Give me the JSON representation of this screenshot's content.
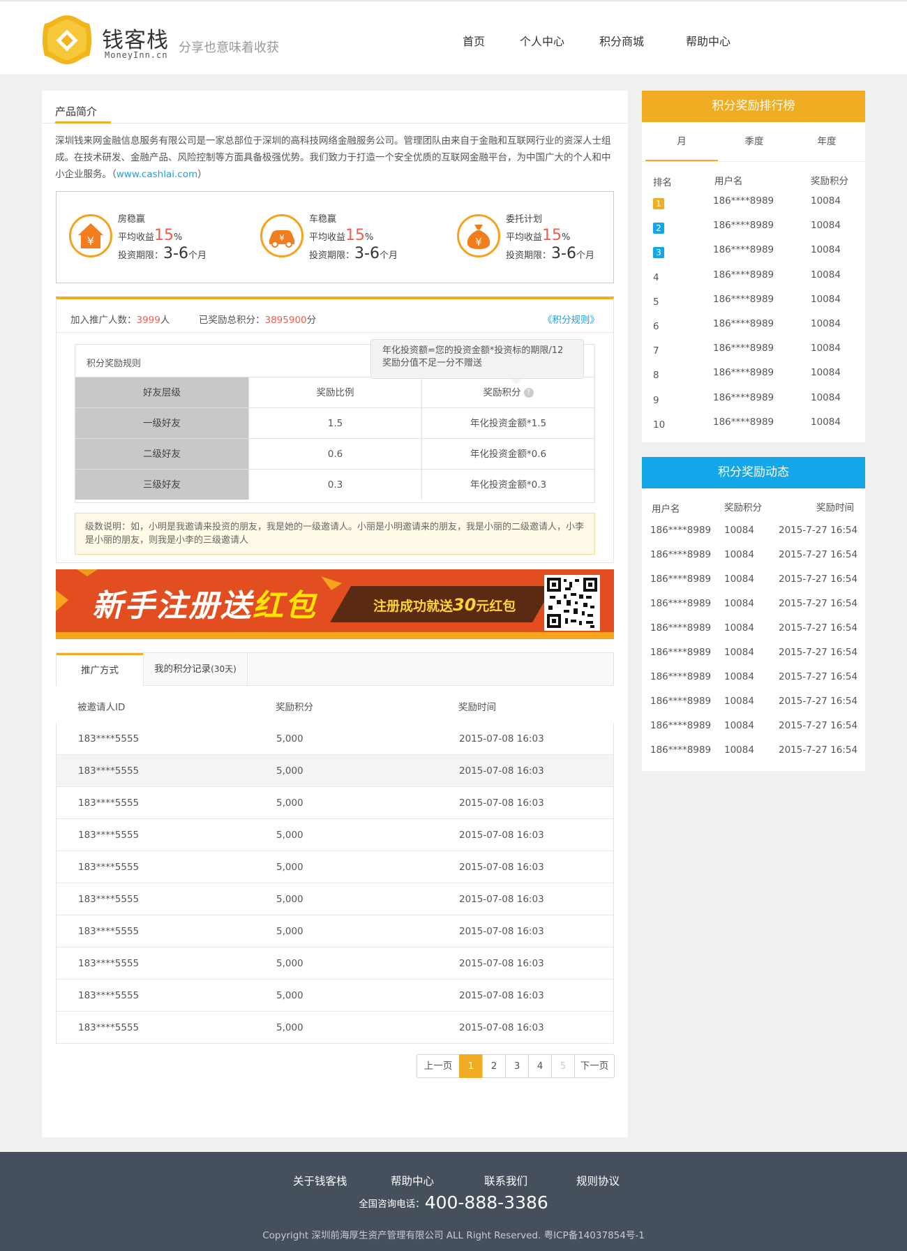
{
  "header": {
    "logo_text": "钱客栈",
    "logo_sub": "MoneyInn.cn",
    "slogan": "分享也意味着收获",
    "nav": [
      "首页",
      "个人中心",
      "积分商城",
      "帮助中心"
    ]
  },
  "intro": {
    "title": "产品简介",
    "text": "深圳钱来网金融信息服务有限公司是一家总部位于深圳的高科技网络金融服务公司。管理团队由来自于金融和互联网行业的资深人士组成。在技术研发、金融产品、风险控制等方面具备极强优势。我们致力于打造一个安全优质的互联网金融平台，为中国广大的个人和中小企业服务。（",
    "link": "www.cashlai.com",
    "tail": "）"
  },
  "products": [
    {
      "name": "房稳赢",
      "icon": "house-yuan-icon",
      "rate_label": "平均收益",
      "rate": "15",
      "rate_unit": "%",
      "term_label": "投资期限：",
      "term": "3-6",
      "term_unit": "个月"
    },
    {
      "name": "车稳赢",
      "icon": "car-yuan-icon",
      "rate_label": "平均收益",
      "rate": "15",
      "rate_unit": "%",
      "term_label": "投资期限：",
      "term": "3-6",
      "term_unit": "个月"
    },
    {
      "name": "委托计划",
      "icon": "moneybag-yuan-icon",
      "rate_label": "平均收益",
      "rate": "15",
      "rate_unit": "%",
      "term_label": "投资期限：",
      "term": "3-6",
      "term_unit": "个月"
    }
  ],
  "promo": {
    "joined_label": "加入推广人数：",
    "joined_value": "3999",
    "joined_unit": "人",
    "points_label": "已奖励总积分：",
    "points_value": "3895900",
    "points_unit": "分",
    "rules_link": "《积分规则》",
    "rules_title": "积分奖励规则",
    "tooltip_line1": "年化投资额=您的投资金额*投资标的期限/12",
    "tooltip_line2": "奖励分值不足一分不赠送",
    "headers": [
      "好友层级",
      "奖励比例",
      "奖励积分"
    ],
    "rows": [
      [
        "一级好友",
        "1.5",
        "年化投资金额*1.5"
      ],
      [
        "二级好友",
        "0.6",
        "年化投资金额*0.6"
      ],
      [
        "三级好友",
        "0.3",
        "年化投资金额*0.3"
      ]
    ],
    "note": "级数说明：如，小明是我邀请来投资的朋友，我是她的一级邀请人。小丽是小明邀请来的朋友，我是小丽的二级邀请人，小李是小丽的朋友，则我是小李的三级邀请人"
  },
  "banner": {
    "main_a": "新手注册送",
    "main_b": "红包",
    "sub_a": "注册成功就送",
    "sub_num": "30",
    "sub_b": "元红包"
  },
  "records": {
    "tabs": [
      "推广方式",
      "我的积分记录"
    ],
    "tab2_suffix": "(30天)",
    "headers": [
      "被邀请人ID",
      "奖励积分",
      "奖励时间"
    ],
    "rows": [
      [
        "183****5555",
        "5,000",
        "2015-07-08  16:03"
      ],
      [
        "183****5555",
        "5,000",
        "2015-07-08  16:03"
      ],
      [
        "183****5555",
        "5,000",
        "2015-07-08  16:03"
      ],
      [
        "183****5555",
        "5,000",
        "2015-07-08  16:03"
      ],
      [
        "183****5555",
        "5,000",
        "2015-07-08  16:03"
      ],
      [
        "183****5555",
        "5,000",
        "2015-07-08  16:03"
      ],
      [
        "183****5555",
        "5,000",
        "2015-07-08  16:03"
      ],
      [
        "183****5555",
        "5,000",
        "2015-07-08  16:03"
      ],
      [
        "183****5555",
        "5,000",
        "2015-07-08  16:03"
      ],
      [
        "183****5555",
        "5,000",
        "2015-07-08  16:03"
      ]
    ]
  },
  "pager": {
    "prev": "上一页",
    "pages": [
      "1",
      "2",
      "3",
      "4",
      "5"
    ],
    "next": "下一页",
    "current": "1"
  },
  "ranking": {
    "title": "积分奖励排行榜",
    "tabs": [
      "月",
      "季度",
      "年度"
    ],
    "headers": [
      "排名",
      "用户名",
      "奖励积分"
    ],
    "rows": [
      [
        "1",
        "186****8989",
        "10084"
      ],
      [
        "2",
        "186****8989",
        "10084"
      ],
      [
        "3",
        "186****8989",
        "10084"
      ],
      [
        "4",
        "186****8989",
        "10084"
      ],
      [
        "5",
        "186****8989",
        "10084"
      ],
      [
        "6",
        "186****8989",
        "10084"
      ],
      [
        "7",
        "186****8989",
        "10084"
      ],
      [
        "8",
        "186****8989",
        "10084"
      ],
      [
        "9",
        "186****8989",
        "10084"
      ],
      [
        "10",
        "186****8989",
        "10084"
      ]
    ]
  },
  "feed": {
    "title": "积分奖励动态",
    "headers": [
      "用户名",
      "奖励积分",
      "奖励时间"
    ],
    "rows": [
      [
        "186****8989",
        "10084",
        "2015-7-27  16:54"
      ],
      [
        "186****8989",
        "10084",
        "2015-7-27  16:54"
      ],
      [
        "186****8989",
        "10084",
        "2015-7-27  16:54"
      ],
      [
        "186****8989",
        "10084",
        "2015-7-27  16:54"
      ],
      [
        "186****8989",
        "10084",
        "2015-7-27  16:54"
      ],
      [
        "186****8989",
        "10084",
        "2015-7-27  16:54"
      ],
      [
        "186****8989",
        "10084",
        "2015-7-27  16:54"
      ],
      [
        "186****8989",
        "10084",
        "2015-7-27  16:54"
      ],
      [
        "186****8989",
        "10084",
        "2015-7-27  16:54"
      ],
      [
        "186****8989",
        "10084",
        "2015-7-27  16:54"
      ]
    ]
  },
  "footer": {
    "links": [
      "关于钱客栈",
      "帮助中心",
      "联系我们",
      "规则协议"
    ],
    "hotline_label": "全国咨询电话：",
    "hotline": "400-888-3386",
    "copyright": "Copyright  深圳前海厚生资产管理有限公司  ALL Right Reserved. 粤ICP备14037854号-1"
  },
  "colors": {
    "accent": "#f0ac23",
    "blue": "#1aa1e6",
    "red": "#f25d4b",
    "footer": "#464f5c"
  }
}
